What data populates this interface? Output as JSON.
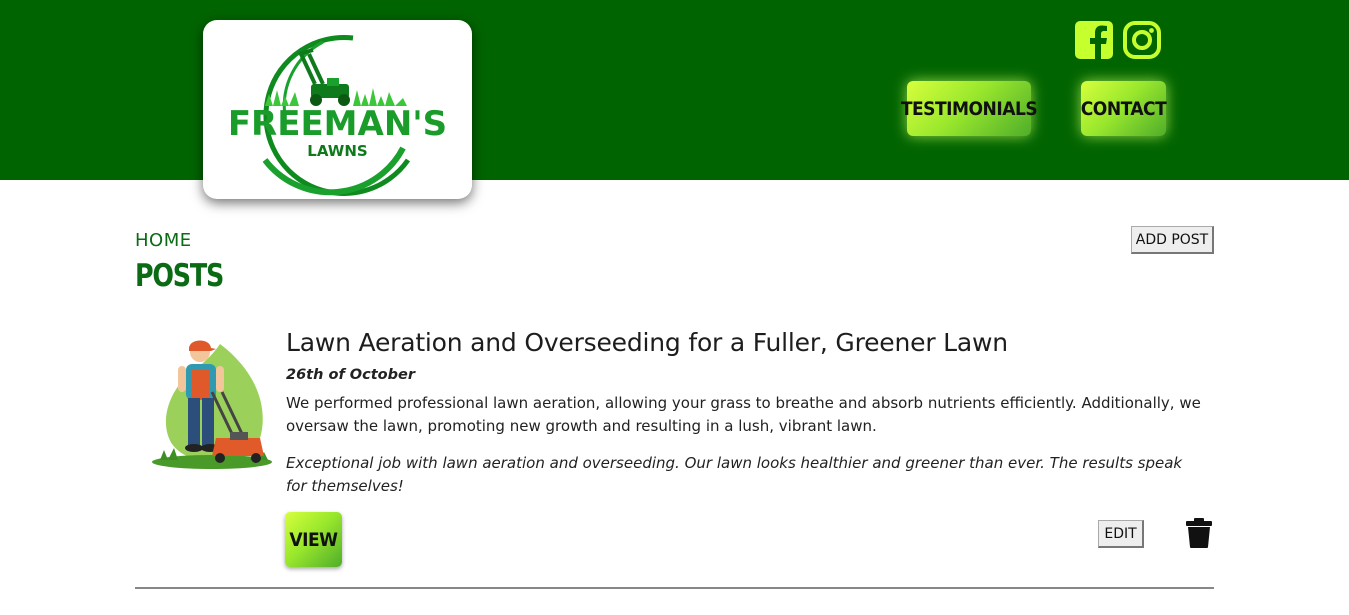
{
  "header": {
    "logo": {
      "line1": "FREEMAN'S",
      "line2": "LAWNS"
    },
    "social": [
      {
        "name": "facebook",
        "icon": "facebook-icon"
      },
      {
        "name": "instagram",
        "icon": "instagram-icon"
      }
    ],
    "nav": {
      "testimonials_label": "TESTIMONIALS",
      "contact_label": "CONTACT"
    }
  },
  "page": {
    "breadcrumb": "HOME",
    "title": "POSTS",
    "add_post_label": "ADD POST"
  },
  "posts": [
    {
      "title": "Lawn Aeration and Overseeding for a Fuller, Greener Lawn",
      "date": "26th of October",
      "body": "We performed professional lawn aeration, allowing your grass to breathe and absorb nutrients efficiently. Additionally, we oversaw the lawn, promoting new growth and resulting in a lush, vibrant lawn.",
      "quote": "Exceptional job with lawn aeration and overseeding. Our lawn looks healthier and greener than ever. The results speak for themselves!",
      "view_label": "VIEW",
      "edit_label": "EDIT",
      "delete_icon": "trash-icon"
    }
  ],
  "colors": {
    "header_bg": "#006400",
    "accent_green": "#0a6b14",
    "button_gradient_start": "#d7ff3d",
    "button_gradient_end": "#4fae2a",
    "social_icon": "#c6ff2e"
  }
}
